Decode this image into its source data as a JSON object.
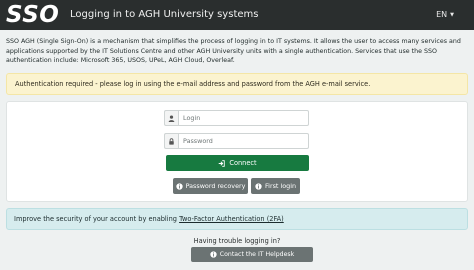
{
  "header": {
    "logo_text": "SSO",
    "title": "Logging in to AGH University systems",
    "language": "EN"
  },
  "intro": "SSO AGH (Single Sign-On) is a mechanism that simplifies the process of logging in to IT systems. It allows the user to access many services and applications supported by the IT Solutions Centre and other AGH University units with a single authentication. Services that use the SSO authentication include: Microsoft 365, USOS, UPeL, AGH Cloud, Overleaf.",
  "auth_notice": "Authentication required - please log in using the e-mail address and password from the AGH e-mail service.",
  "form": {
    "login_placeholder": "Login",
    "password_placeholder": "Password",
    "connect_label": "Connect",
    "recovery_label": "Password recovery",
    "first_login_label": "First login"
  },
  "security_notice": {
    "text": "Improve the security of your account by enabling ",
    "link": "Two-Factor Authentication (2FA)"
  },
  "help": {
    "question": "Having trouble logging in?",
    "button_label": "Contact the IT Helpdesk"
  },
  "colors": {
    "topbar": "#2a2e2e",
    "connect": "#177a40",
    "secondary": "#6b7373",
    "warning_bg": "#fbf3cf",
    "info_bg": "#d6ecee"
  }
}
